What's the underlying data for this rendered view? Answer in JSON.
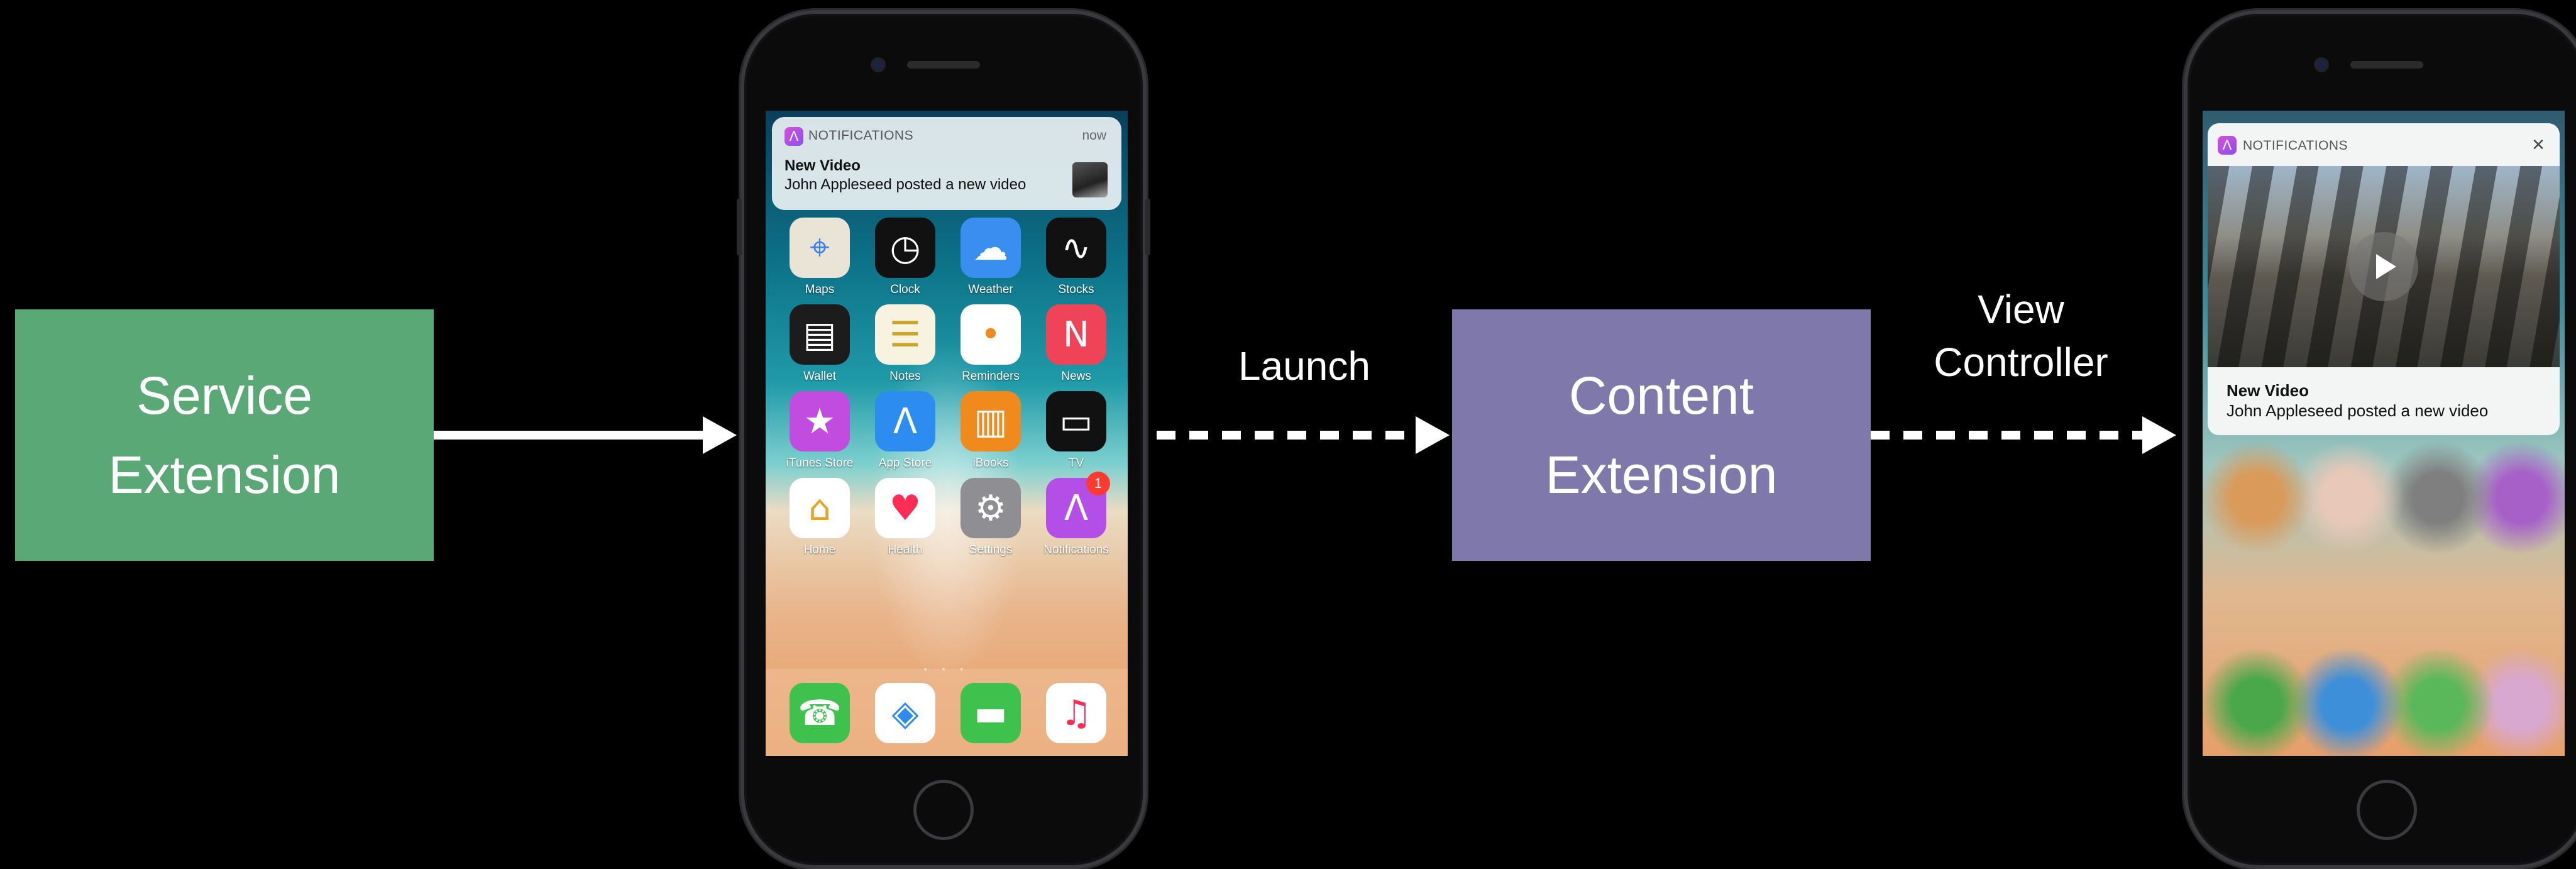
{
  "diagram": {
    "service_extension": {
      "line1": "Service",
      "line2": "Extension"
    },
    "content_extension": {
      "line1": "Content",
      "line2": "Extension"
    },
    "launch_label": "Launch",
    "view_controller_label": {
      "line1": "View",
      "line2": "Controller"
    },
    "colors": {
      "service": "#5aa876",
      "content": "#7f78aa",
      "background": "#000000",
      "arrow": "#ffffff"
    }
  },
  "phone1": {
    "notification": {
      "app_name": "NOTIFICATIONS",
      "time": "now",
      "title": "New Video",
      "body": "John Appleseed posted a new video"
    },
    "apps": [
      {
        "label": "Maps",
        "icon": "maps-icon",
        "color": "#e9e4d6"
      },
      {
        "label": "Clock",
        "icon": "clock-icon",
        "color": "#111111"
      },
      {
        "label": "Weather",
        "icon": "weather-icon",
        "color": "#3a8ef0"
      },
      {
        "label": "Stocks",
        "icon": "stocks-icon",
        "color": "#111111"
      },
      {
        "label": "Wallet",
        "icon": "wallet-icon",
        "color": "#1c1c1c"
      },
      {
        "label": "Notes",
        "icon": "notes-icon",
        "color": "#f7f3e0"
      },
      {
        "label": "Reminders",
        "icon": "reminders-icon",
        "color": "#ffffff"
      },
      {
        "label": "News",
        "icon": "news-icon",
        "color": "#ef4458"
      },
      {
        "label": "iTunes Store",
        "icon": "itunes-store-icon",
        "color": "#c34ce0"
      },
      {
        "label": "App Store",
        "icon": "app-store-icon",
        "color": "#2d8cf0"
      },
      {
        "label": "iBooks",
        "icon": "ibooks-icon",
        "color": "#f08a1d"
      },
      {
        "label": "TV",
        "icon": "tv-icon",
        "color": "#111111"
      },
      {
        "label": "Home",
        "icon": "home-icon",
        "color": "#ffffff"
      },
      {
        "label": "Health",
        "icon": "health-icon",
        "color": "#ffffff"
      },
      {
        "label": "Settings",
        "icon": "settings-icon",
        "color": "#8e8e93"
      },
      {
        "label": "Notifications",
        "icon": "notifications-app-icon",
        "color": "#b34fe6",
        "badge": "1"
      }
    ],
    "dock": [
      {
        "icon": "phone-icon",
        "color": "#3ec24d"
      },
      {
        "icon": "safari-icon",
        "color": "#ffffff"
      },
      {
        "icon": "messages-icon",
        "color": "#3ec24d"
      },
      {
        "icon": "music-icon",
        "color": "#ffffff"
      }
    ]
  },
  "phone2": {
    "notification": {
      "app_name": "NOTIFICATIONS",
      "title": "New Video",
      "body": "John Appleseed posted a new video"
    }
  }
}
